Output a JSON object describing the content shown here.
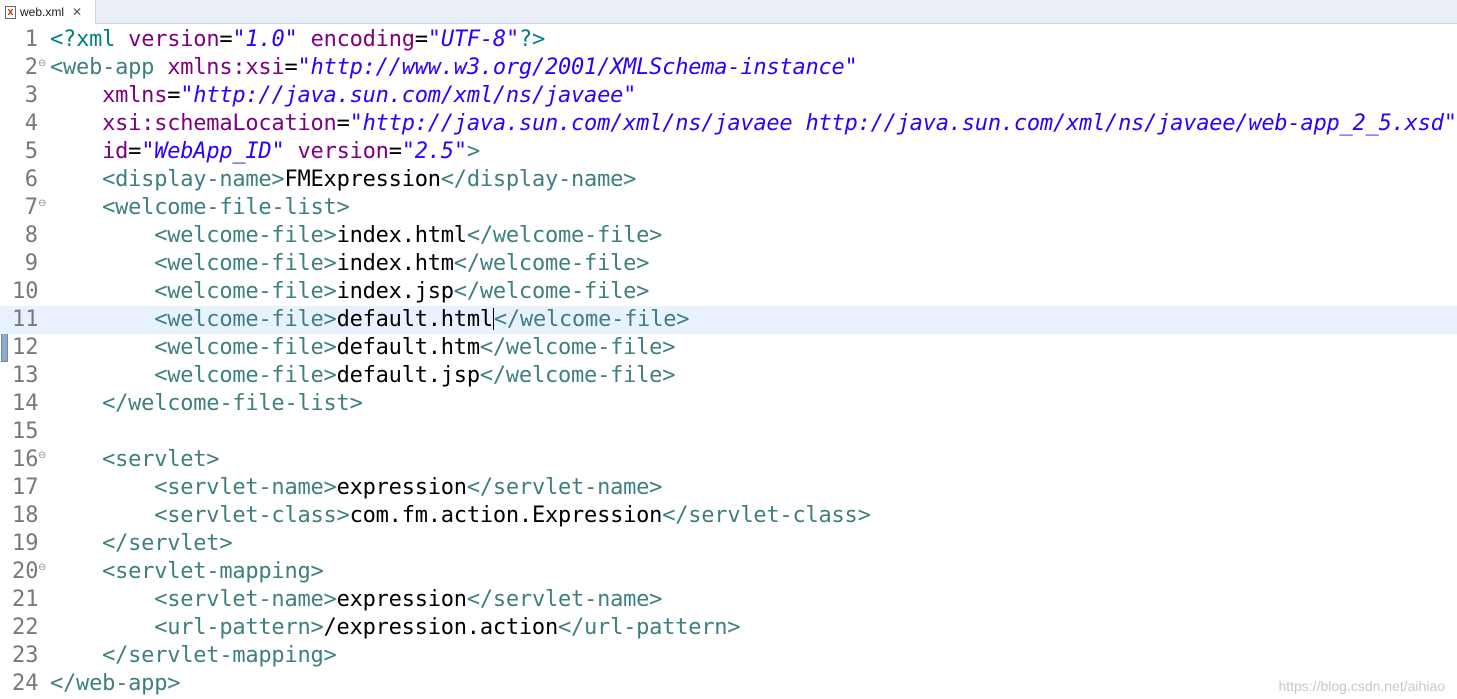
{
  "tab": {
    "title": "web.xml",
    "icon": "xml-file-icon",
    "close_symbol": "✕"
  },
  "colors": {
    "tag": "#3f7f7f",
    "attribute": "#7f007f",
    "value": "#2a00ff",
    "text": "#000000",
    "current_line": "#e8f2fe"
  },
  "editor": {
    "current_line": 11,
    "lines": [
      {
        "n": "1",
        "fold": "",
        "code": [
          [
            "p",
            "<?"
          ],
          [
            "p",
            "xml "
          ],
          [
            "a",
            "version"
          ],
          [
            "x",
            "="
          ],
          [
            "v",
            "\"1.0\""
          ],
          [
            "x",
            " "
          ],
          [
            "a",
            "encoding"
          ],
          [
            "x",
            "="
          ],
          [
            "v",
            "\"UTF-8\""
          ],
          [
            "p",
            "?>"
          ]
        ]
      },
      {
        "n": "2",
        "fold": "⊖",
        "code": [
          [
            "t",
            "<web-app "
          ],
          [
            "a",
            "xmlns:xsi"
          ],
          [
            "x",
            "="
          ],
          [
            "v",
            "\"http://www.w3.org/2001/XMLSchema-instance\""
          ]
        ]
      },
      {
        "n": "3",
        "fold": "",
        "code": [
          [
            "x",
            "    "
          ],
          [
            "a",
            "xmlns"
          ],
          [
            "x",
            "="
          ],
          [
            "v",
            "\"http://java.sun.com/xml/ns/javaee\""
          ]
        ]
      },
      {
        "n": "4",
        "fold": "",
        "code": [
          [
            "x",
            "    "
          ],
          [
            "a",
            "xsi:schemaLocation"
          ],
          [
            "x",
            "="
          ],
          [
            "v",
            "\"http://java.sun.com/xml/ns/javaee http://java.sun.com/xml/ns/javaee/web-app_2_5.xsd\""
          ]
        ]
      },
      {
        "n": "5",
        "fold": "",
        "code": [
          [
            "x",
            "    "
          ],
          [
            "a",
            "id"
          ],
          [
            "x",
            "="
          ],
          [
            "v",
            "\"WebApp_ID\""
          ],
          [
            "x",
            " "
          ],
          [
            "a",
            "version"
          ],
          [
            "x",
            "="
          ],
          [
            "v",
            "\"2.5\""
          ],
          [
            "t",
            ">"
          ]
        ]
      },
      {
        "n": "6",
        "fold": "",
        "code": [
          [
            "x",
            "    "
          ],
          [
            "t",
            "<display-name>"
          ],
          [
            "x",
            "FMExpression"
          ],
          [
            "t",
            "</display-name>"
          ]
        ]
      },
      {
        "n": "7",
        "fold": "⊖",
        "code": [
          [
            "x",
            "    "
          ],
          [
            "t",
            "<welcome-file-list>"
          ]
        ]
      },
      {
        "n": "8",
        "fold": "",
        "code": [
          [
            "x",
            "        "
          ],
          [
            "t",
            "<welcome-file>"
          ],
          [
            "x",
            "index.html"
          ],
          [
            "t",
            "</welcome-file>"
          ]
        ]
      },
      {
        "n": "9",
        "fold": "",
        "code": [
          [
            "x",
            "        "
          ],
          [
            "t",
            "<welcome-file>"
          ],
          [
            "x",
            "index.htm"
          ],
          [
            "t",
            "</welcome-file>"
          ]
        ]
      },
      {
        "n": "10",
        "fold": "",
        "code": [
          [
            "x",
            "        "
          ],
          [
            "t",
            "<welcome-file>"
          ],
          [
            "x",
            "index.jsp"
          ],
          [
            "t",
            "</welcome-file>"
          ]
        ]
      },
      {
        "n": "11",
        "fold": "",
        "code": [
          [
            "x",
            "        "
          ],
          [
            "t",
            "<welcome-file>"
          ],
          [
            "x",
            "default.html"
          ],
          [
            "caret",
            ""
          ],
          [
            "t",
            "</welcome-file>"
          ]
        ]
      },
      {
        "n": "12",
        "fold": "",
        "code": [
          [
            "x",
            "        "
          ],
          [
            "t",
            "<welcome-file>"
          ],
          [
            "x",
            "default.htm"
          ],
          [
            "t",
            "</welcome-file>"
          ]
        ]
      },
      {
        "n": "13",
        "fold": "",
        "code": [
          [
            "x",
            "        "
          ],
          [
            "t",
            "<welcome-file>"
          ],
          [
            "x",
            "default.jsp"
          ],
          [
            "t",
            "</welcome-file>"
          ]
        ]
      },
      {
        "n": "14",
        "fold": "",
        "code": [
          [
            "x",
            "    "
          ],
          [
            "t",
            "</welcome-file-list>"
          ]
        ]
      },
      {
        "n": "15",
        "fold": "",
        "code": []
      },
      {
        "n": "16",
        "fold": "⊖",
        "code": [
          [
            "x",
            "    "
          ],
          [
            "t",
            "<servlet>"
          ]
        ]
      },
      {
        "n": "17",
        "fold": "",
        "code": [
          [
            "x",
            "        "
          ],
          [
            "t",
            "<servlet-name>"
          ],
          [
            "x",
            "expression"
          ],
          [
            "t",
            "</servlet-name>"
          ]
        ]
      },
      {
        "n": "18",
        "fold": "",
        "code": [
          [
            "x",
            "        "
          ],
          [
            "t",
            "<servlet-class>"
          ],
          [
            "x",
            "com.fm.action.Expression"
          ],
          [
            "t",
            "</servlet-class>"
          ]
        ]
      },
      {
        "n": "19",
        "fold": "",
        "code": [
          [
            "x",
            "    "
          ],
          [
            "t",
            "</servlet>"
          ]
        ]
      },
      {
        "n": "20",
        "fold": "⊖",
        "code": [
          [
            "x",
            "    "
          ],
          [
            "t",
            "<servlet-mapping>"
          ]
        ]
      },
      {
        "n": "21",
        "fold": "",
        "code": [
          [
            "x",
            "        "
          ],
          [
            "t",
            "<servlet-name>"
          ],
          [
            "x",
            "expression"
          ],
          [
            "t",
            "</servlet-name>"
          ]
        ]
      },
      {
        "n": "22",
        "fold": "",
        "code": [
          [
            "x",
            "        "
          ],
          [
            "t",
            "<url-pattern>"
          ],
          [
            "x",
            "/expression.action"
          ],
          [
            "t",
            "</url-pattern>"
          ]
        ]
      },
      {
        "n": "23",
        "fold": "",
        "code": [
          [
            "x",
            "    "
          ],
          [
            "t",
            "</servlet-mapping>"
          ]
        ]
      },
      {
        "n": "24",
        "fold": "",
        "code": [
          [
            "t",
            "</web-app>"
          ]
        ]
      }
    ]
  },
  "watermark": "https://blog.csdn.net/aihiao"
}
